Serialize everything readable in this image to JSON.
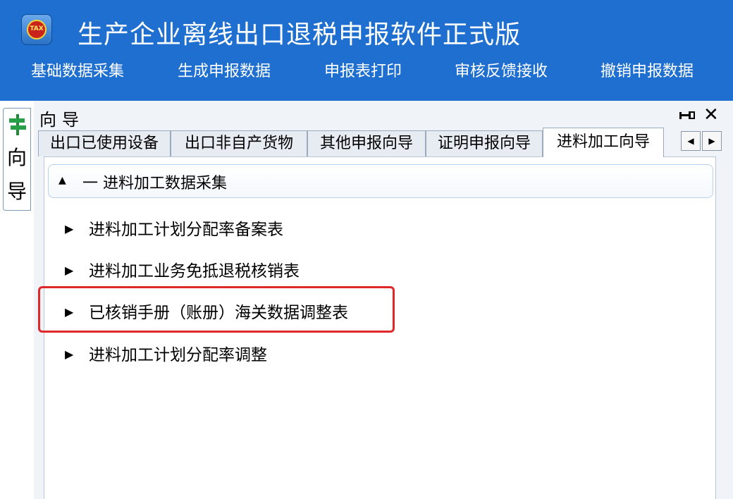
{
  "app": {
    "title": "生产企业离线出口退税申报软件正式版",
    "logo_text": "TAX"
  },
  "menu": [
    {
      "label": "基础数据采集"
    },
    {
      "label": "生成申报数据"
    },
    {
      "label": "申报表打印"
    },
    {
      "label": "审核反馈接收"
    },
    {
      "label": "撤销申报数据"
    }
  ],
  "side_tab": {
    "label": "向\n导"
  },
  "panel": {
    "title": "向导"
  },
  "tabs": [
    {
      "label": "出口已使用设备"
    },
    {
      "label": "出口非自产货物"
    },
    {
      "label": "其他申报向导"
    },
    {
      "label": "证明申报向导"
    },
    {
      "label": "进料加工向导",
      "active": true
    }
  ],
  "tab_scroll": {
    "left": "◀",
    "right": "▶"
  },
  "group": {
    "label": "一  进料加工数据采集",
    "collapse_glyph": "▲",
    "items": [
      {
        "label": "进料加工计划分配率备案表"
      },
      {
        "label": "进料加工业务免抵退税核销表"
      },
      {
        "label": "已核销手册（账册）海关数据调整表",
        "highlighted": true
      },
      {
        "label": "进料加工计划分配率调整"
      }
    ]
  },
  "colors": {
    "header_bg": "#1e6fd0",
    "highlight": "#e0282a",
    "panel_bg": "#f0f4f9"
  }
}
